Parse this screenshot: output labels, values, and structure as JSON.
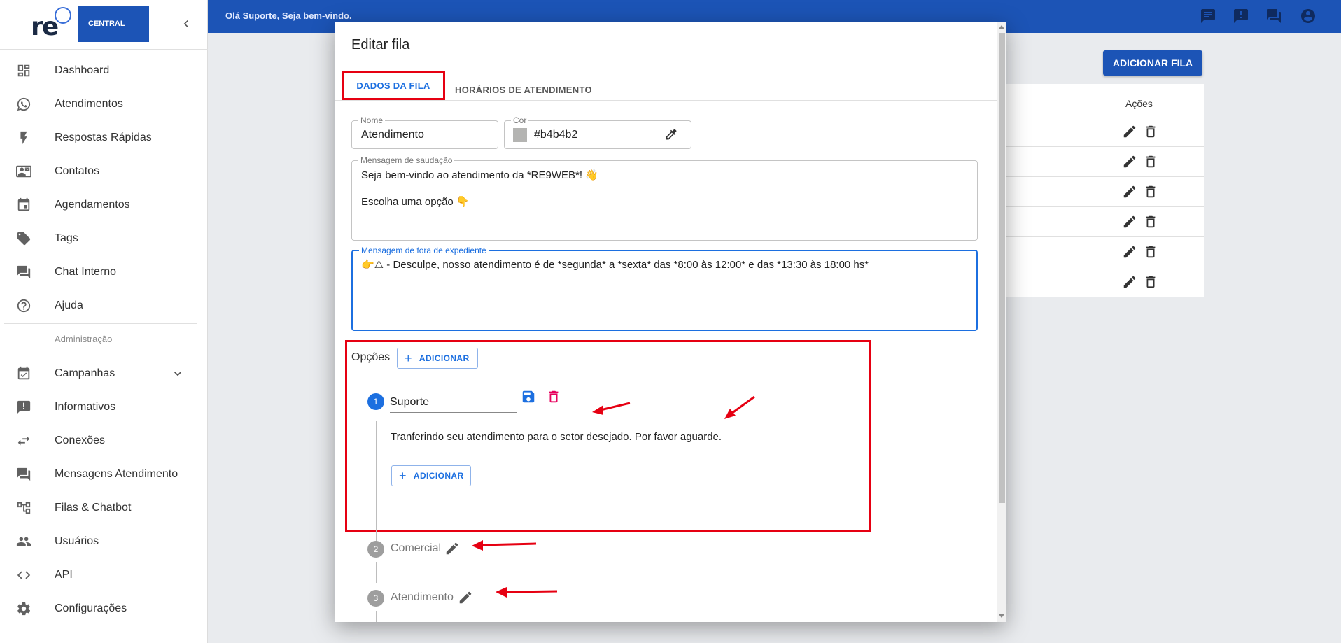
{
  "topbar": {
    "greeting": "Olá Suporte, Seja bem-vindo."
  },
  "logo": {
    "brand_text": "re",
    "sub_text": "CENTRAL"
  },
  "sidebar": {
    "items": [
      {
        "label": "Dashboard",
        "icon": "dashboard-icon"
      },
      {
        "label": "Atendimentos",
        "icon": "whatsapp-icon"
      },
      {
        "label": "Respostas Rápidas",
        "icon": "flash-icon"
      },
      {
        "label": "Contatos",
        "icon": "contact-card-icon"
      },
      {
        "label": "Agendamentos",
        "icon": "calendar-icon"
      },
      {
        "label": "Tags",
        "icon": "tag-icon"
      },
      {
        "label": "Chat Interno",
        "icon": "chat-icon"
      },
      {
        "label": "Ajuda",
        "icon": "help-icon"
      }
    ],
    "admin_section_label": "Administração",
    "admin_items": [
      {
        "label": "Campanhas",
        "icon": "event-check-icon"
      },
      {
        "label": "Informativos",
        "icon": "announcement-icon"
      },
      {
        "label": "Conexões",
        "icon": "swap-icon"
      },
      {
        "label": "Mensagens Atendimento",
        "icon": "forum-icon"
      },
      {
        "label": "Filas & Chatbot",
        "icon": "account-tree-icon"
      },
      {
        "label": "Usuários",
        "icon": "people-icon"
      },
      {
        "label": "API",
        "icon": "code-icon"
      },
      {
        "label": "Configurações",
        "icon": "settings-icon"
      }
    ]
  },
  "background": {
    "add_fila_label": "ADICIONAR FILA",
    "acoes_header": "Ações"
  },
  "modal": {
    "title": "Editar fila",
    "tabs": [
      {
        "label": "DADOS DA FILA",
        "active": true
      },
      {
        "label": "HORÁRIOS DE ATENDIMENTO",
        "active": false
      }
    ],
    "nome": {
      "label": "Nome",
      "value": "Atendimento"
    },
    "cor": {
      "label": "Cor",
      "value": "#b4b4b2",
      "swatch": "#b4b4b2"
    },
    "saudacao": {
      "label": "Mensagem de saudação",
      "line1": "Seja bem-vindo ao atendimento da *RE9WEB*! 👋",
      "line2": "Escolha uma opção 👇"
    },
    "fora_expediente": {
      "label": "Mensagem de fora de expediente",
      "value": "👉⚠ - Desculpe, nosso atendimento é de *segunda* a *sexta* das *8:00 às 12:00* e das *13:30 às 18:00 hs*"
    },
    "opcoes": {
      "label": "Opções",
      "add_label": "ADICIONAR",
      "steps": [
        {
          "number": "1",
          "name": "Suporte",
          "message": "Tranferindo seu atendimento para o setor desejado. Por favor aguarde.",
          "add_label": "ADICIONAR"
        },
        {
          "number": "2",
          "name": "Comercial"
        },
        {
          "number": "3",
          "name": "Atendimento"
        }
      ]
    }
  },
  "colors": {
    "primary": "#1c54b6",
    "accent": "#1c6fe0",
    "highlight": "#e60012",
    "delete": "#e6005c"
  }
}
